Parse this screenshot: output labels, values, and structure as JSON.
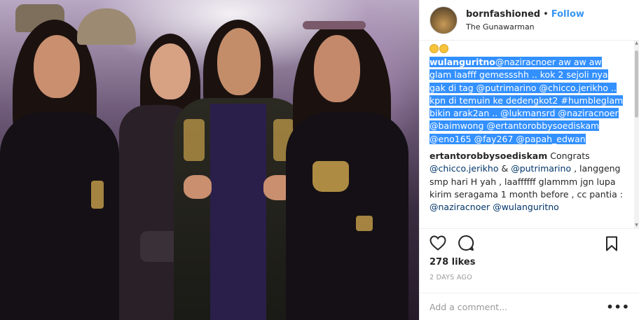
{
  "header": {
    "username": "bornfashioned",
    "separator": "•",
    "follow_label": "Follow",
    "location": "The Gunawarman"
  },
  "comments": [
    {
      "username": "wulanguritno",
      "selected": true,
      "parts": [
        {
          "type": "mention",
          "text": "@naziracnoer"
        },
        {
          "type": "text",
          "text": " aw aw aw glam laafff gemessshh .. kok 2 sejoli nya gak di tag "
        },
        {
          "type": "mention",
          "text": "@putrimarino"
        },
        {
          "type": "text",
          "text": " "
        },
        {
          "type": "mention",
          "text": "@chicco.jerikho"
        },
        {
          "type": "text",
          "text": " .. kpn di temuin ke dedengkot2 #humbleglam bikin arak2an .. "
        },
        {
          "type": "mention",
          "text": "@lukmansrd"
        },
        {
          "type": "text",
          "text": " "
        },
        {
          "type": "mention",
          "text": "@naziracnoer"
        },
        {
          "type": "text",
          "text": " "
        },
        {
          "type": "mention",
          "text": "@baimwong"
        },
        {
          "type": "text",
          "text": " "
        },
        {
          "type": "mention",
          "text": "@ertantorobbysoediskam"
        },
        {
          "type": "text",
          "text": " "
        },
        {
          "type": "mention",
          "text": "@eno165"
        },
        {
          "type": "text",
          "text": " "
        },
        {
          "type": "mention",
          "text": "@fay267"
        },
        {
          "type": "text",
          "text": " "
        },
        {
          "type": "mention",
          "text": "@papah_edwan"
        }
      ]
    },
    {
      "username": "ertantorobbysoediskam",
      "selected": false,
      "parts": [
        {
          "type": "text",
          "text": " Congrats "
        },
        {
          "type": "mention",
          "text": "@chicco.jerikho"
        },
        {
          "type": "text",
          "text": " & "
        },
        {
          "type": "mention",
          "text": "@putrimarino"
        },
        {
          "type": "text",
          "text": " , langgeng smp hari H yah , laaffffff glammm jgn lupa kirim seragama 1 month before , cc pantia : "
        },
        {
          "type": "mention",
          "text": "@naziracnoer"
        },
        {
          "type": "text",
          "text": " "
        },
        {
          "type": "mention",
          "text": "@wulanguritno"
        }
      ]
    }
  ],
  "likes_text": "278 likes",
  "timestamp": "2 DAYS AGO",
  "add_comment": {
    "placeholder": "Add a comment..."
  },
  "more_label": "•••",
  "scroll": {
    "up": "▲",
    "down": "▼"
  },
  "icons": {
    "like": "heart-icon",
    "comment": "comment-bubble-icon",
    "save": "bookmark-icon",
    "more": "more-options-icon"
  },
  "colors": {
    "follow": "#3897f0",
    "selection": "#3390ff",
    "mention": "#003569",
    "muted": "#999999"
  }
}
